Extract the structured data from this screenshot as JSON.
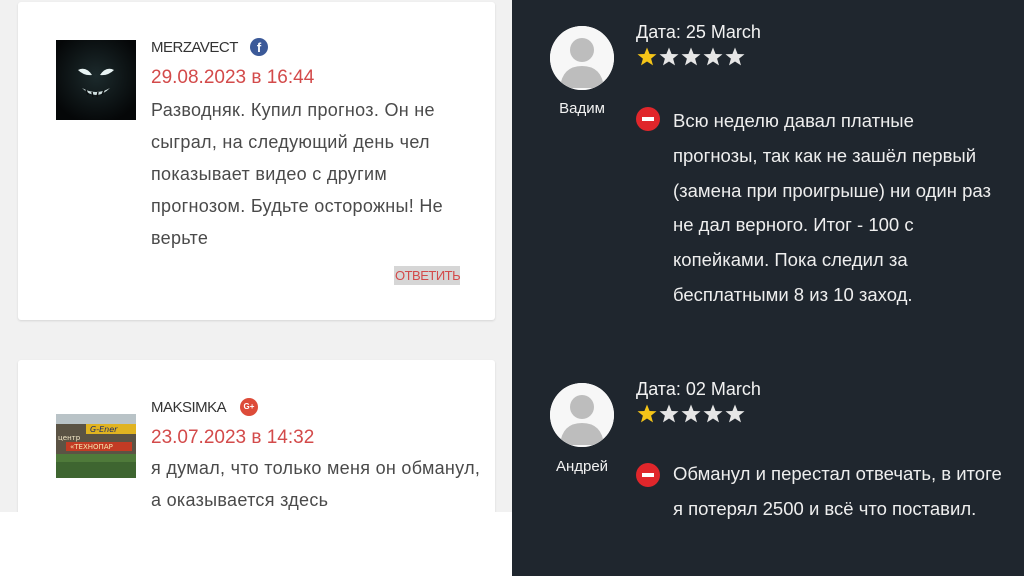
{
  "comments": [
    {
      "author": "MERZAVECT",
      "network_icon": "facebook-icon",
      "network_glyph": "f",
      "date": "29.08.2023 в 16:44",
      "text": "Разводняк. Купил прогноз. Он не сыграл, на следующий день чел показывает видео с другим прогнозом. Будьте осторожны! Не верьте",
      "reply_label": "ОТВЕТИТЬ"
    },
    {
      "author": "MAKSIMKA",
      "network_icon": "google-plus-icon",
      "network_glyph": "G+",
      "date": "23.07.2023 в 14:32",
      "text": "я думал, что только меня он обманул, а оказывается здесь"
    }
  ],
  "reviews": [
    {
      "name": "Вадим",
      "date": "Дата: 25 March",
      "rating": 1,
      "max_rating": 5,
      "text": "Всю неделю давал платные прогнозы, так как не зашёл первый (замена при проигрыше) ни один раз не дал верного. Итог - 100 с копейками. Пока следил за бесплатными 8 из 10 заход."
    },
    {
      "name": "Андрей",
      "date": "Дата: 02 March",
      "rating": 1,
      "max_rating": 5,
      "text": "Обманул и перестал отвечать, в итоге я потерял 2500 и всё что поставил."
    }
  ],
  "colors": {
    "accent_red": "#d34a4a",
    "dark_bg": "#1f262e",
    "star_filled": "#f5c518",
    "star_empty": "#e6e6e6",
    "negative_badge": "#e0262b"
  }
}
